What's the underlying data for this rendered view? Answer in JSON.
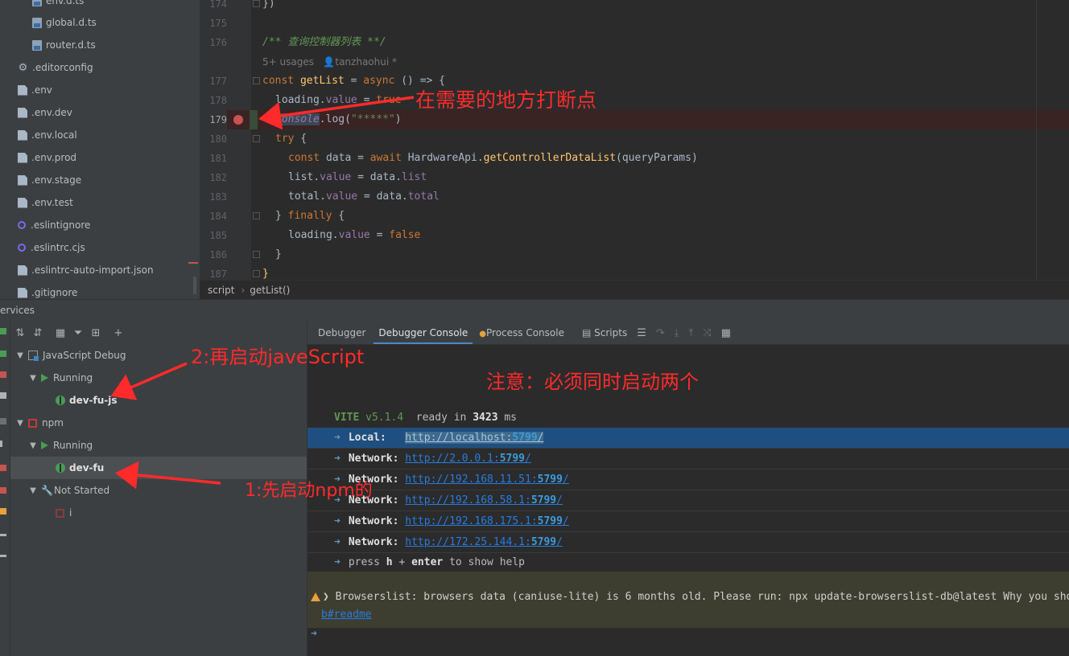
{
  "project_tree": {
    "items": [
      {
        "label": "env.d.ts",
        "icon": "ts-file-icon"
      },
      {
        "label": "global.d.ts",
        "icon": "ts-file-icon"
      },
      {
        "label": "router.d.ts",
        "icon": "ts-file-icon"
      },
      {
        "label": ".editorconfig",
        "icon": "gear-icon"
      },
      {
        "label": ".env",
        "icon": "file-icon"
      },
      {
        "label": ".env.dev",
        "icon": "file-icon"
      },
      {
        "label": ".env.local",
        "icon": "file-icon"
      },
      {
        "label": ".env.prod",
        "icon": "file-icon"
      },
      {
        "label": ".env.stage",
        "icon": "file-icon"
      },
      {
        "label": ".env.test",
        "icon": "file-icon"
      },
      {
        "label": ".eslintignore",
        "icon": "eslint-icon"
      },
      {
        "label": ".eslintrc.cjs",
        "icon": "eslint-icon"
      },
      {
        "label": ".eslintrc-auto-import.json",
        "icon": "json-file-icon"
      },
      {
        "label": ".gitignore",
        "icon": "git-file-icon"
      }
    ]
  },
  "editor": {
    "line_numbers": [
      "174",
      "175",
      "176",
      "",
      "177",
      "178",
      "179",
      "180",
      "181",
      "182",
      "183",
      "184",
      "185",
      "186",
      "187"
    ],
    "comment": "/** 查询控制器列表 **/",
    "usages": "5+ usages",
    "author": "tanzhaohui *",
    "breakpoint_line": "179",
    "code": {
      "l174": "})",
      "l177_const": "const ",
      "l177_name": "getList",
      "l177_rest1": " = ",
      "l177_async": "async",
      "l177_rest2": " () => {",
      "l178_a": "loading.",
      "l178_b": "value",
      "l178_c": " = ",
      "l178_d": "true",
      "l179_a": "console",
      "l179_b": ".log(",
      "l179_c": "\"*****\"",
      "l179_d": ")",
      "l180_a": "try",
      "l180_b": " {",
      "l181_a": "const ",
      "l181_b": "data = ",
      "l181_c": "await ",
      "l181_d": "HardwareApi.",
      "l181_e": "getControllerDataList",
      "l181_f": "(queryParams)",
      "l182_a": "list.",
      "l182_b": "value",
      "l182_c": " = data.",
      "l182_d": "list",
      "l183_a": "total.",
      "l183_b": "value",
      "l183_c": " = data.",
      "l183_d": "total",
      "l184_a": "} ",
      "l184_b": "finally",
      "l184_c": " {",
      "l185_a": "loading.",
      "l185_b": "value",
      "l185_c": " = ",
      "l185_d": "false",
      "l186": "}",
      "l187": "}"
    }
  },
  "breadcrumb": {
    "items": [
      "script",
      "getList()"
    ],
    "separator": "›"
  },
  "services": {
    "header": "ervices",
    "tree": {
      "js_debug": "JavaScript Debug",
      "running1": "Running",
      "dev_fu_js": "dev-fu-js",
      "npm": "npm",
      "running2": "Running",
      "dev_fu": "dev-fu",
      "not_started": "Not Started",
      "i": "i"
    }
  },
  "console": {
    "tabs": {
      "debugger": "Debugger",
      "debugger_console": "Debugger Console",
      "process_console": "Process Console",
      "scripts": "Scripts"
    },
    "vite_label": "VITE",
    "vite_version": "v5.1.4",
    "ready_pre": "ready in ",
    "ready_ms": "3423",
    "ready_post": " ms",
    "arrow": "➜",
    "rows": [
      {
        "label": "Local:",
        "url_pre": "http://localhost:",
        "port": "5799",
        "url_post": "/"
      },
      {
        "label": "Network:",
        "url_pre": "http://2.0.0.1:",
        "port": "5799",
        "url_post": "/"
      },
      {
        "label": "Network:",
        "url_pre": "http://192.168.11.51:",
        "port": "5799",
        "url_post": "/"
      },
      {
        "label": "Network:",
        "url_pre": "http://192.168.58.1:",
        "port": "5799",
        "url_post": "/"
      },
      {
        "label": "Network:",
        "url_pre": "http://192.168.175.1:",
        "port": "5799",
        "url_post": "/"
      },
      {
        "label": "Network:",
        "url_pre": "http://172.25.144.1:",
        "port": "5799",
        "url_post": "/"
      }
    ],
    "help_pre": "press ",
    "help_h": "h",
    "help_mid": " + ",
    "help_enter": "enter",
    "help_post": " to show help",
    "warning": "Browserslist: browsers data (caniuse-lite) is 6 months old. Please run: npx update-browserslist-db@latest Why you sho",
    "warning_link": "b#readme",
    "prompt": "➜"
  },
  "annotations": {
    "breakpoint_note": "在需要的地方打断点",
    "start_js": "2:再启动javeScript",
    "must_both": "注意：必须同时启动两个",
    "start_npm": "1:先启动npm的"
  },
  "colors": {
    "annotation": "#ff2a2a",
    "breakpoint": "#c75450",
    "selection": "#1f4f80"
  }
}
